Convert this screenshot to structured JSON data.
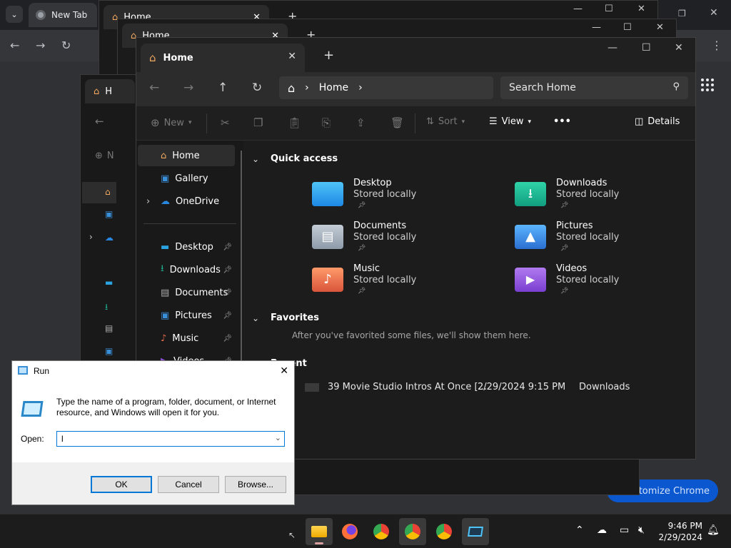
{
  "chrome": {
    "tab_title": "New Tab",
    "customize_label": "Customize Chrome"
  },
  "bg_windows": {
    "tab1_title": "Home",
    "tab2_title": "Home",
    "tab3_title": "Home",
    "new_label": "New"
  },
  "explorer": {
    "tab_title": "Home",
    "breadcrumb": "Home",
    "search_placeholder": "Search Home",
    "toolbar": {
      "new_label": "New",
      "sort_label": "Sort",
      "view_label": "View",
      "more_label": "•••",
      "details_label": "Details"
    },
    "sidebar": [
      {
        "label": "Home",
        "icon": "home-icon",
        "pinned": false
      },
      {
        "label": "Gallery",
        "icon": "gallery-icon",
        "pinned": false
      },
      {
        "label": "OneDrive",
        "icon": "cloud-icon",
        "pinned": false
      },
      {
        "label": "Desktop",
        "icon": "desktop-icon",
        "pinned": true
      },
      {
        "label": "Downloads",
        "icon": "download-icon",
        "pinned": true
      },
      {
        "label": "Documents",
        "icon": "document-icon",
        "pinned": true
      },
      {
        "label": "Pictures",
        "icon": "picture-icon",
        "pinned": true
      },
      {
        "label": "Music",
        "icon": "music-icon",
        "pinned": true
      },
      {
        "label": "Videos",
        "icon": "video-icon",
        "pinned": true
      }
    ],
    "quick_access_title": "Quick access",
    "quick_access": [
      {
        "name": "Desktop",
        "sub": "Stored locally",
        "color": "#2aa3e0"
      },
      {
        "name": "Downloads",
        "sub": "Stored locally",
        "color": "#1fae8f"
      },
      {
        "name": "Documents",
        "sub": "Stored locally",
        "color": "#8d9aa8"
      },
      {
        "name": "Pictures",
        "sub": "Stored locally",
        "color": "#3a8fd9"
      },
      {
        "name": "Music",
        "sub": "Stored locally",
        "color": "#e06a4a"
      },
      {
        "name": "Videos",
        "sub": "Stored locally",
        "color": "#8a4fd8"
      }
    ],
    "favorites_title": "Favorites",
    "favorites_empty": "After you've favorited some files, we'll show them here.",
    "recent_title": "Recent",
    "recent": [
      {
        "name": "39 Movie Studio Intros At Once [...",
        "date": "2/29/2024 9:15 PM",
        "location": "Downloads"
      }
    ]
  },
  "run_dialog": {
    "title": "Run",
    "description": "Type the name of a program, folder, document, or Internet resource, and Windows will open it for you.",
    "open_label": "Open:",
    "input_value": "l",
    "ok_label": "OK",
    "cancel_label": "Cancel",
    "browse_label": "Browse..."
  },
  "taskbar": {
    "time": "9:46 PM",
    "date": "2/29/2024"
  }
}
